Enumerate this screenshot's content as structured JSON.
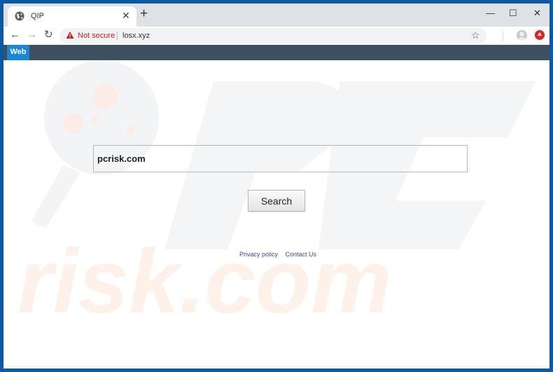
{
  "browser": {
    "tab": {
      "title": "QIP",
      "favicon": "globe-icon",
      "close_glyph": "✕"
    },
    "new_tab_glyph": "+",
    "window_controls": {
      "minimize": "—",
      "maximize": "☐",
      "close": "✕"
    },
    "nav": {
      "back": "←",
      "forward": "→",
      "reload": "↻"
    },
    "address_bar": {
      "security_label": "Not secure",
      "url": "losx.xyz",
      "bookmark_glyph": "☆"
    },
    "colors": {
      "frame": "#0b5aa5",
      "not_secure": "#c5221f",
      "extension": "#e02424"
    }
  },
  "page": {
    "nav_tabs": [
      {
        "label": "Web",
        "active": true
      }
    ],
    "search": {
      "value": "pcrisk.com",
      "button_label": "Search"
    },
    "footer_links": [
      "Privacy policy",
      "Contact Us"
    ],
    "colors": {
      "nav_bar": "#3e5060",
      "active_tab": "#1a86d6",
      "link": "#3b4f8f"
    }
  },
  "watermark": {
    "text": "risk.com",
    "logo_letters": "PC"
  }
}
